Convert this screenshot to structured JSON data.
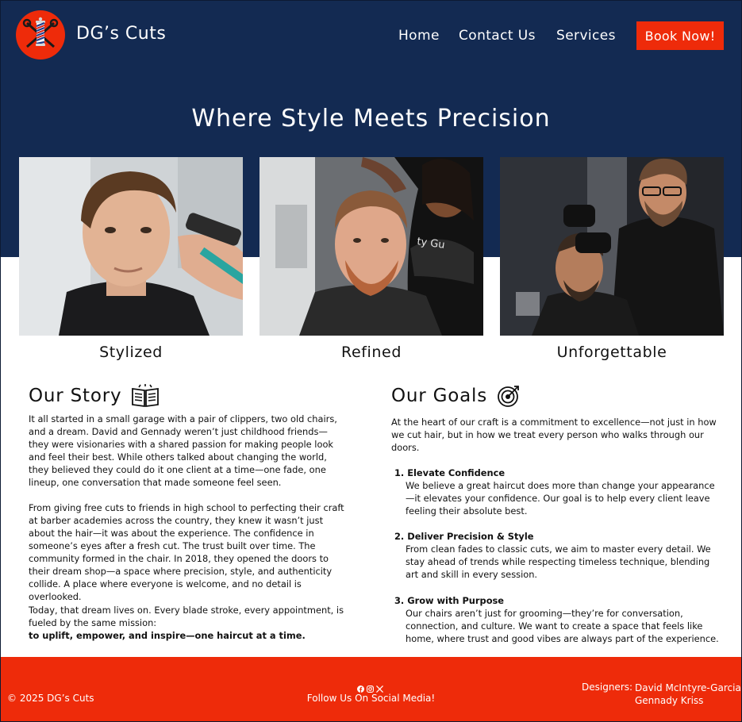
{
  "header": {
    "brand": "DG’s Cuts",
    "nav": {
      "home": "Home",
      "contact": "Contact Us",
      "services": "Services"
    },
    "cta": "Book Now!",
    "logo_icon": "barber-pole-scissors-logo"
  },
  "hero": {
    "title": "Where Style Meets Precision",
    "captions": [
      "Stylized",
      "Refined",
      "Unforgettable"
    ]
  },
  "story": {
    "title": "Our Story",
    "icon": "open-book-icon",
    "p1": "It all started in a small garage with a pair of clippers, two old chairs, and a dream.  David and Gennady weren’t just childhood friends—they were visionaries with a shared passion for making people look and feel their best. While others talked about changing the world, they believed they could do it one client at a time—one fade, one lineup, one conversation that made someone feel seen.",
    "p2": "From giving free cuts to friends in high school to perfecting their craft at barber academies across the country, they knew it wasn’t just about the hair—it was about the experience. The confidence in someone’s eyes after a fresh cut. The trust built over time. The community formed in the chair.  In 2018, they opened the doors to their dream shop—a space where precision, style, and authenticity collide. A place where everyone is welcome, and no detail is overlooked.",
    "p3": "Today, that dream lives on. Every blade stroke, every appointment, is fueled by the same mission:",
    "mission": "to uplift, empower, and inspire—one haircut at a time."
  },
  "goals": {
    "title": "Our Goals",
    "icon": "target-icon",
    "intro": "At the heart of our craft is a commitment to excellence—not just in how we cut hair, but in how we treat every person who walks through our doors.",
    "items": [
      {
        "num": "1.",
        "title": "Elevate Confidence",
        "desc": "We believe a great haircut does more than change your appearance—it elevates your confidence. Our goal is to help every client leave feeling their absolute best."
      },
      {
        "num": "2.",
        "title": "Deliver Precision & Style",
        "desc": "From clean fades to classic cuts, we aim to master every detail. We stay ahead of trends while respecting timeless technique, blending art and skill in every session."
      },
      {
        "num": "3.",
        "title": "Grow with Purpose",
        "desc": "Our chairs aren’t just for grooming—they’re for conversation, connection, and culture. We want to create a space that feels like home, where trust and good vibes are always part of the experience."
      }
    ]
  },
  "footer": {
    "copyright": "© 2025 DG’s Cuts",
    "follow": "Follow Us On Social Media!",
    "social_icons": [
      "facebook-icon",
      "instagram-icon",
      "x-icon"
    ],
    "designers_label": "Designers:",
    "designers": [
      "David McIntyre-Garcia",
      "Gennady Kriss"
    ]
  },
  "colors": {
    "navy": "#132a52",
    "accent": "#ee2b0a",
    "text": "#111111",
    "white": "#ffffff"
  }
}
